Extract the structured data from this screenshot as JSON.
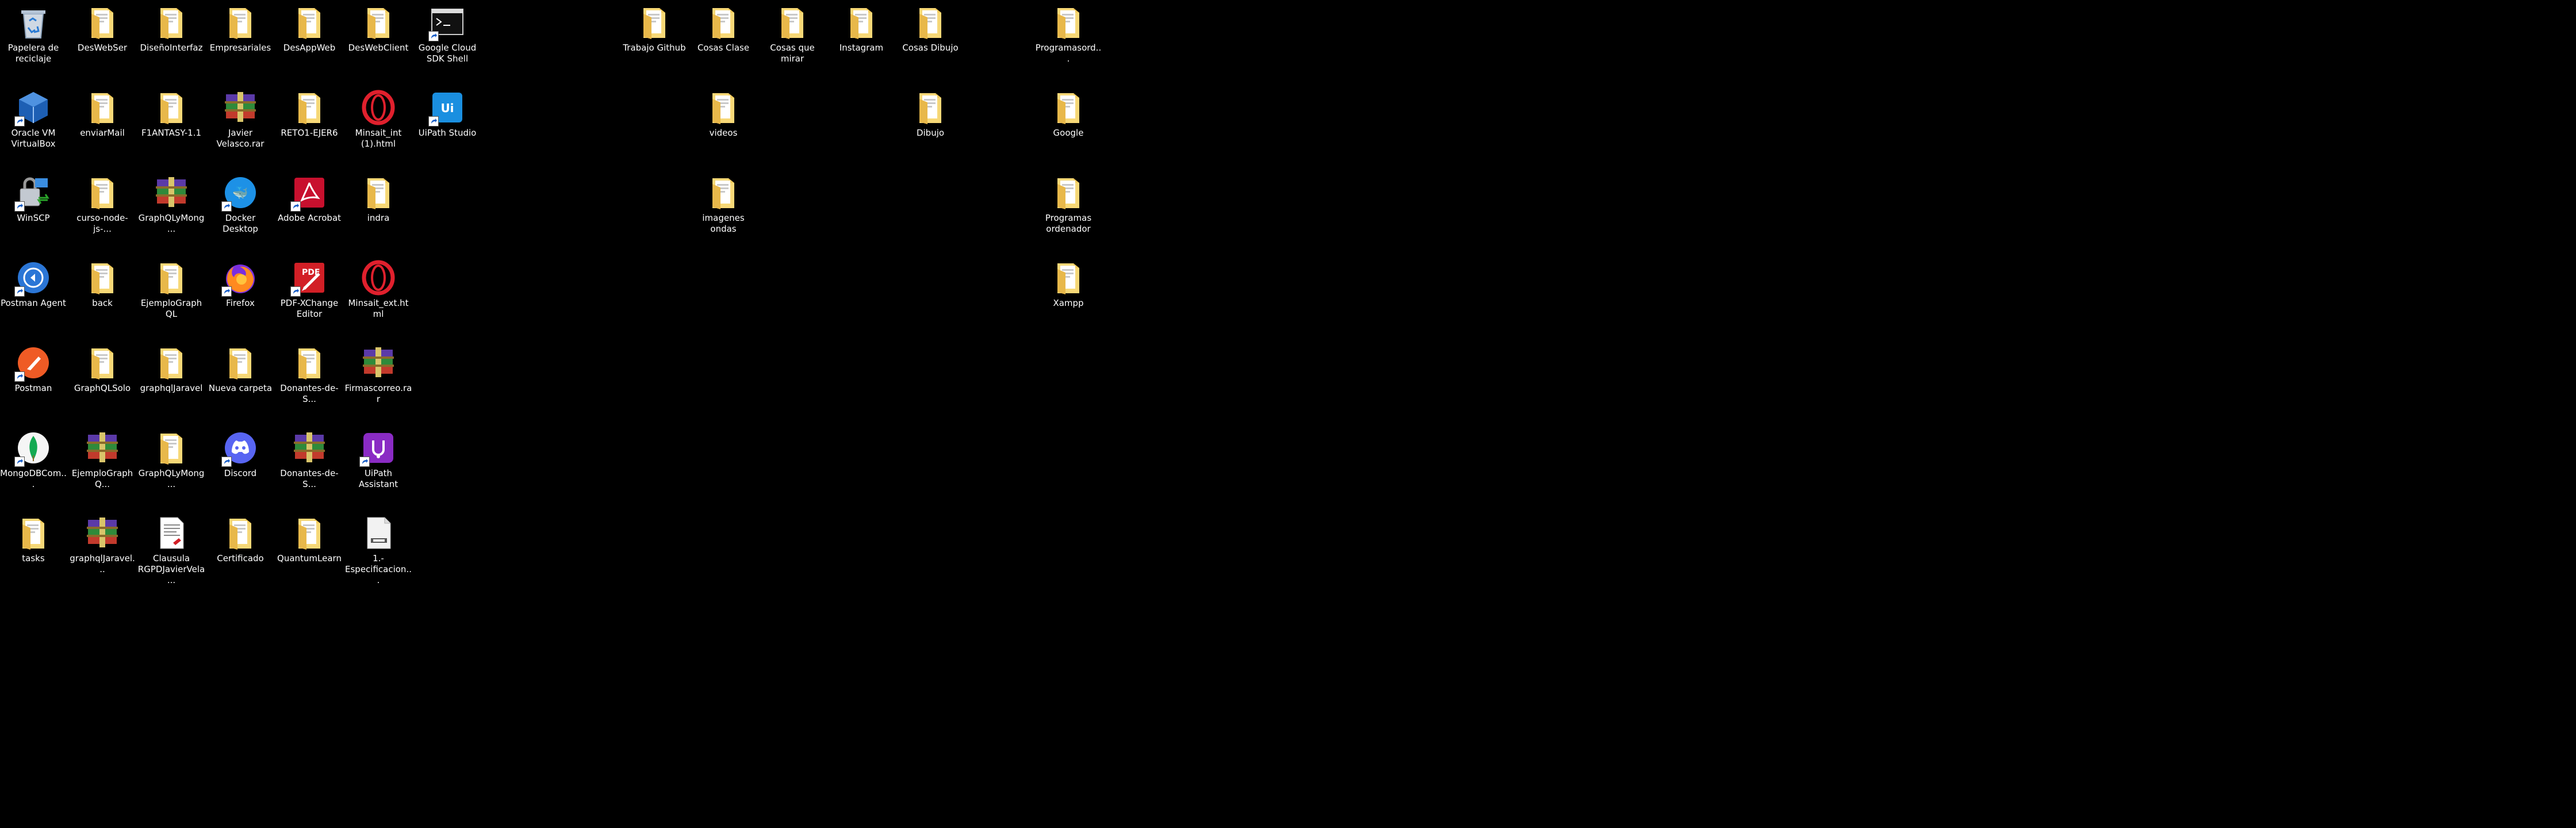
{
  "desktop": {
    "icons": [
      {
        "label": "Papelera de reciclaje",
        "icon": "recycle-bin-icon",
        "shortcut": false
      },
      {
        "label": "DesWebSer",
        "icon": "folder-icon",
        "shortcut": false
      },
      {
        "label": "DiseñoInterfaz",
        "icon": "folder-icon",
        "shortcut": false
      },
      {
        "label": "Empresariales",
        "icon": "folder-icon",
        "shortcut": false
      },
      {
        "label": "DesAppWeb",
        "icon": "folder-icon",
        "shortcut": false
      },
      {
        "label": "DesWebClient",
        "icon": "folder-icon",
        "shortcut": false
      },
      {
        "label": "Google Cloud SDK Shell",
        "icon": "terminal-icon",
        "shortcut": true
      },
      {
        "label": "Oracle VM VirtualBox",
        "icon": "virtualbox-icon",
        "shortcut": true
      },
      {
        "label": "enviarMail",
        "icon": "folder-icon",
        "shortcut": false
      },
      {
        "label": "F1ANTASY-1.1",
        "icon": "folder-icon",
        "shortcut": false
      },
      {
        "label": "Javier Velasco.rar",
        "icon": "winrar-icon",
        "shortcut": false
      },
      {
        "label": "RETO1-EJER6",
        "icon": "folder-icon",
        "shortcut": false
      },
      {
        "label": "Minsait_int (1).html",
        "icon": "opera-icon",
        "shortcut": false
      },
      {
        "label": "UiPath Studio",
        "icon": "uipath-studio-icon",
        "shortcut": true
      },
      {
        "label": "WinSCP",
        "icon": "winscp-icon",
        "shortcut": true
      },
      {
        "label": "curso-node-js-...",
        "icon": "folder-icon",
        "shortcut": false
      },
      {
        "label": "GraphQLyMong...",
        "icon": "winrar-icon",
        "shortcut": false
      },
      {
        "label": "Docker Desktop",
        "icon": "docker-icon",
        "shortcut": true
      },
      {
        "label": "Adobe Acrobat",
        "icon": "acrobat-icon",
        "shortcut": true
      },
      {
        "label": "indra",
        "icon": "folder-icon",
        "shortcut": false
      },
      {
        "label": "Postman Agent",
        "icon": "postman-agent-icon",
        "shortcut": true
      },
      {
        "label": "back",
        "icon": "folder-icon",
        "shortcut": false
      },
      {
        "label": "EjemploGraphQL",
        "icon": "folder-icon",
        "shortcut": false
      },
      {
        "label": "Firefox",
        "icon": "firefox-icon",
        "shortcut": true
      },
      {
        "label": "PDF-XChange Editor",
        "icon": "pdf-xchange-icon",
        "shortcut": true
      },
      {
        "label": "Minsait_ext.html",
        "icon": "opera-icon",
        "shortcut": false
      },
      {
        "label": "Postman",
        "icon": "postman-icon",
        "shortcut": true
      },
      {
        "label": "GraphQLSolo",
        "icon": "folder-icon",
        "shortcut": false
      },
      {
        "label": "graphqlJaravel",
        "icon": "folder-icon",
        "shortcut": false
      },
      {
        "label": "Nueva carpeta",
        "icon": "folder-icon",
        "shortcut": false
      },
      {
        "label": "Donantes-de-S...",
        "icon": "folder-icon",
        "shortcut": false
      },
      {
        "label": "Firmascorreo.rar",
        "icon": "winrar-icon",
        "shortcut": false
      },
      {
        "label": "MongoDBCom...",
        "icon": "mongodb-compass-icon",
        "shortcut": true
      },
      {
        "label": "EjemploGraphQ...",
        "icon": "winrar-icon",
        "shortcut": false
      },
      {
        "label": "GraphQLyMong...",
        "icon": "folder-icon",
        "shortcut": false
      },
      {
        "label": "Discord",
        "icon": "discord-icon",
        "shortcut": true
      },
      {
        "label": "Donantes-de-S...",
        "icon": "winrar-icon",
        "shortcut": false
      },
      {
        "label": "UiPath Assistant",
        "icon": "uipath-assistant-icon",
        "shortcut": true
      },
      {
        "label": "tasks",
        "icon": "folder-icon",
        "shortcut": false
      },
      {
        "label": "graphqlJaravel...",
        "icon": "winrar-icon",
        "shortcut": false
      },
      {
        "label": "Clausula RGPDJavierVela...",
        "icon": "document-icon",
        "shortcut": false
      },
      {
        "label": "Certificado",
        "icon": "folder-icon",
        "shortcut": false
      },
      {
        "label": "QuantumLearn",
        "icon": "folder-icon",
        "shortcut": false
      },
      {
        "label": "1.- Especificacion...",
        "icon": "docx-file-icon",
        "shortcut": false
      },
      {
        "label": "Trabajo Github",
        "icon": "folder-icon",
        "shortcut": false
      },
      {
        "label": "Cosas Clase",
        "icon": "folder-icon",
        "shortcut": false
      },
      {
        "label": "Cosas que mirar",
        "icon": "folder-icon",
        "shortcut": false
      },
      {
        "label": "Instagram",
        "icon": "folder-icon",
        "shortcut": false
      },
      {
        "label": "Cosas Dibujo",
        "icon": "folder-icon",
        "shortcut": false
      },
      {
        "label": "videos",
        "icon": "folder-icon",
        "shortcut": false
      },
      {
        "label": "Dibujo",
        "icon": "folder-icon",
        "shortcut": false
      },
      {
        "label": "imagenes ondas",
        "icon": "folder-icon",
        "shortcut": false
      },
      {
        "label": "Programasord...",
        "icon": "folder-icon",
        "shortcut": false
      },
      {
        "label": "Google",
        "icon": "folder-icon",
        "shortcut": false
      },
      {
        "label": "Programas ordenador",
        "icon": "folder-icon",
        "shortcut": false
      },
      {
        "label": "Xampp",
        "icon": "folder-icon",
        "shortcut": false
      }
    ]
  }
}
